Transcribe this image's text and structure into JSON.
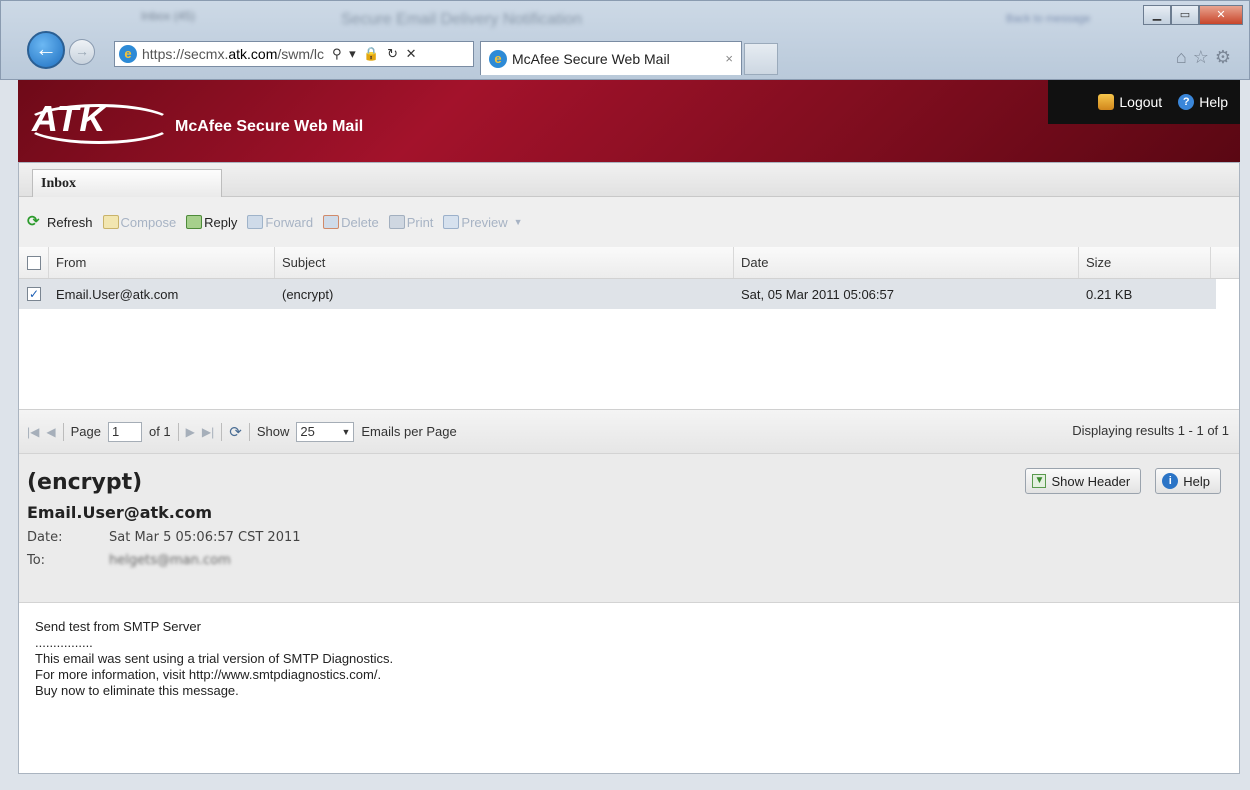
{
  "window": {
    "blurred_title": "Secure Email Delivery Notification",
    "blurred_tab": "Inbox (45)",
    "blurred_right": "Back to message"
  },
  "browser": {
    "url_prefix": "https://secmx.",
    "url_host": "atk.com",
    "url_rest": "/swm/lc",
    "tab_title": "McAfee Secure Web Mail",
    "tab_close": "×"
  },
  "app": {
    "logo": "ATK",
    "title": "McAfee Secure Web Mail",
    "logout_label": "Logout",
    "help_label": "Help"
  },
  "tabs": {
    "inbox": "Inbox"
  },
  "toolbar": {
    "refresh": "Refresh",
    "compose": "Compose",
    "reply": "Reply",
    "forward": "Forward",
    "delete": "Delete",
    "print": "Print",
    "preview": "Preview"
  },
  "grid": {
    "columns": {
      "from": "From",
      "subject": "Subject",
      "date": "Date",
      "size": "Size"
    },
    "rows": [
      {
        "checked": true,
        "from": "Email.User@atk.com",
        "subject": "(encrypt)",
        "date": "Sat, 05 Mar 2011 05:06:57",
        "size": "0.21 KB"
      }
    ]
  },
  "pager": {
    "page_label": "Page",
    "page_value": "1",
    "of_label": "of 1",
    "show_label": "Show",
    "per_page_value": "25",
    "per_page_label": "Emails per Page",
    "status": "Displaying results 1 - 1 of 1"
  },
  "message": {
    "subject": "(encrypt)",
    "sender": "Email.User@atk.com",
    "date_label": "Date:",
    "date_value": "Sat Mar 5 05:06:57 CST 2011",
    "to_label": "To:",
    "to_value": "helgets@man.com",
    "show_header_label": "Show Header",
    "help_label": "Help",
    "body_lines": [
      "Send test from SMTP Server",
      "................",
      "This email was sent using a trial version of SMTP Diagnostics.",
      "For more information, visit http://www.smtpdiagnostics.com/.",
      "Buy now to eliminate this message."
    ]
  }
}
